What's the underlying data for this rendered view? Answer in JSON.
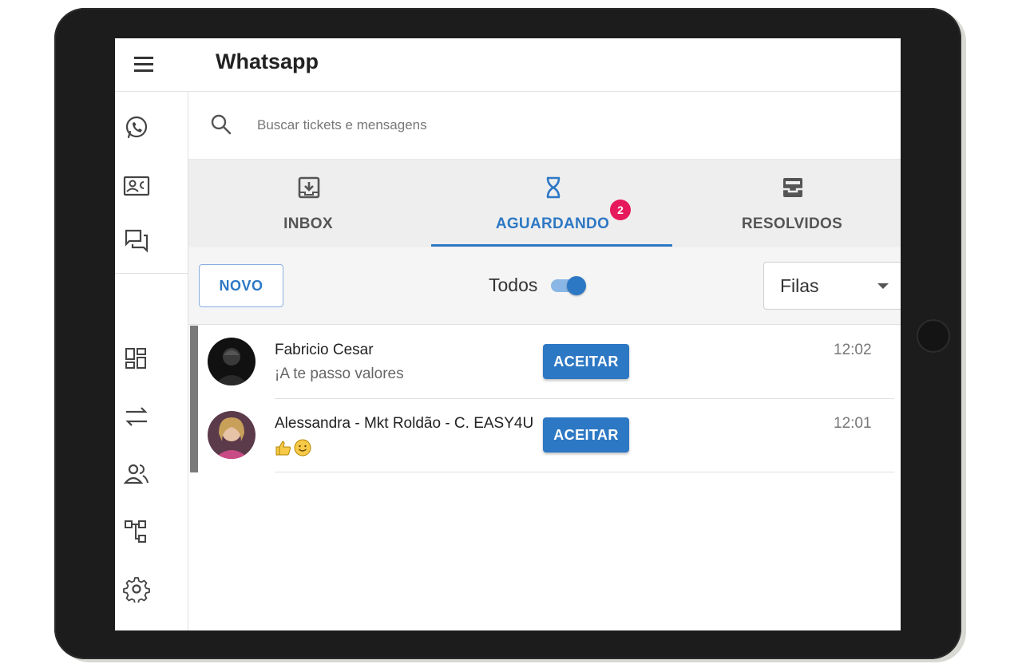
{
  "header": {
    "title": "Whatsapp"
  },
  "search": {
    "placeholder": "Buscar tickets e mensagens"
  },
  "tabs": [
    {
      "label": "INBOX",
      "icon": "inbox-download-icon"
    },
    {
      "label": "AGUARDANDO",
      "icon": "hourglass-icon",
      "badge": "2",
      "active": true
    },
    {
      "label": "RESOLVIDOS",
      "icon": "inbox-archive-icon"
    }
  ],
  "toolbar": {
    "new_label": "NOVO",
    "todos_label": "Todos",
    "todos_on": true,
    "filas_label": "Filas"
  },
  "tickets": [
    {
      "name": "Fabricio Cesar",
      "message": "¡A te passo valores",
      "time": "12:02",
      "action": "ACEITAR"
    },
    {
      "name": "Alessandra - Mkt Roldão - C. EASY4U",
      "message": "",
      "message_icons": [
        "thumbs-up-icon",
        "smiley-icon"
      ],
      "time": "12:01",
      "action": "ACEITAR"
    }
  ],
  "sidebar": {
    "items": [
      "whatsapp-icon",
      "contacts-icon",
      "chats-icon",
      "dashboard-icon",
      "transfer-icon",
      "users-icon",
      "queues-icon",
      "settings-icon"
    ]
  },
  "colors": {
    "accent": "#2d78c4",
    "badge": "#e5195b",
    "tabs_bg": "#eeeeee"
  }
}
